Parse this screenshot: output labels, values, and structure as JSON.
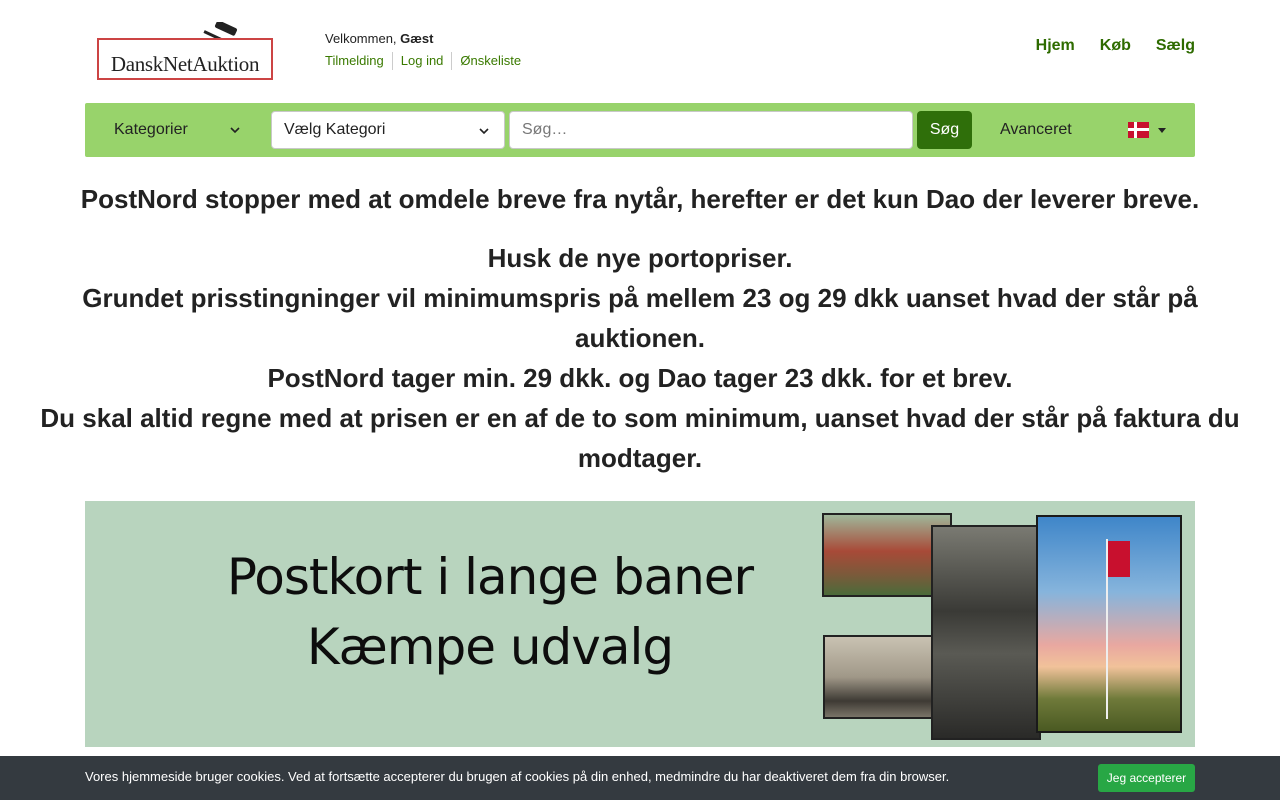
{
  "header": {
    "logo_text": "DanskNetAuktion",
    "welcome_prefix": "Velkommen,",
    "welcome_user": "Gæst",
    "user_links": [
      "Tilmelding",
      "Log ind",
      "Ønskeliste"
    ],
    "nav": [
      "Hjem",
      "Køb",
      "Sælg"
    ]
  },
  "searchbar": {
    "categories_label": "Kategorier",
    "select_value": "Vælg Kategori",
    "search_placeholder": "Søg…",
    "search_button": "Søg",
    "advanced_label": "Avanceret",
    "language_icon": "danish-flag-icon"
  },
  "announcements": {
    "line1": "PostNord stopper med at omdele breve fra nytår, herefter er det kun Dao der leverer breve.",
    "line2": "Husk de nye portopriser.",
    "line3": "Grundet prisstingninger vil minimumspris på mellem 23 og 29 dkk uanset hvad der står på auktionen.",
    "line4": "PostNord tager min. 29 dkk. og Dao tager 23 dkk. for et brev.",
    "line5": "Du skal altid regne med at  prisen er en af de to som minimum, uanset hvad der står på faktura du modtager."
  },
  "banner": {
    "line1": "Postkort i lange baner",
    "line2": "Kæmpe udvalg"
  },
  "cookie": {
    "text": "Vores hjemmeside bruger cookies. Ved at fortsætte accepterer du brugen af cookies på din enhed, medmindre du har deaktiveret dem fra din browser.",
    "accept_button": "Jeg accepterer"
  },
  "colors": {
    "accent_green": "#98d36b",
    "link_green": "#2e6b00",
    "search_button": "#2f6f0a",
    "banner_bg": "#b8d4be",
    "cookie_bg": "#343a40",
    "cookie_button": "#28a745"
  }
}
